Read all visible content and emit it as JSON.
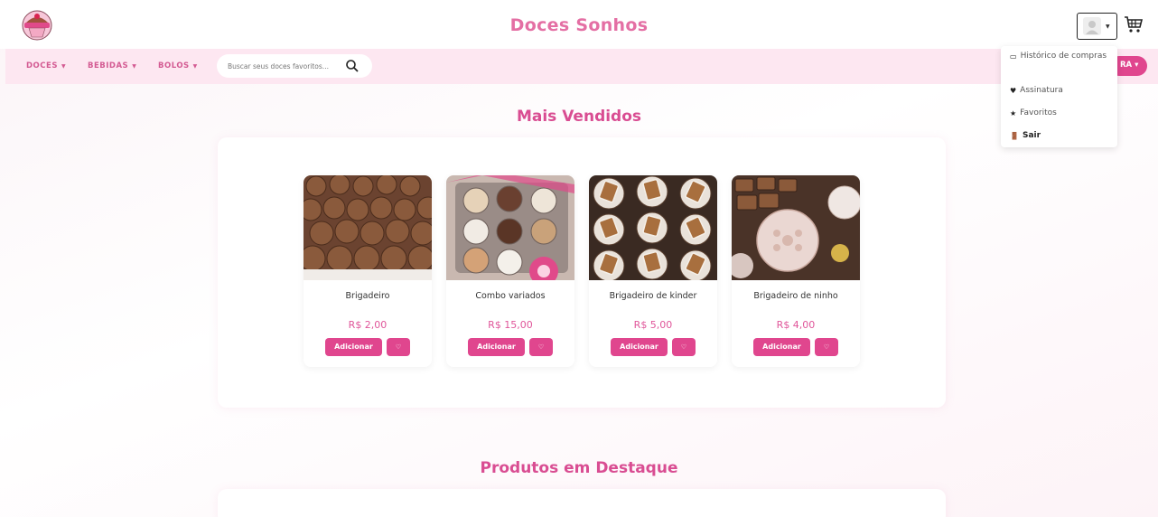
{
  "header": {
    "brand": "Doces Sonhos",
    "logo_icon": "cupcake-logo-icon",
    "user_icon": "user-avatar-icon",
    "cart_icon": "cart-icon"
  },
  "nav": {
    "items": [
      {
        "label": "DOCES"
      },
      {
        "label": "BEBIDAS"
      },
      {
        "label": "BOLOS"
      }
    ],
    "search_placeholder": "Buscar seus doces favoritos...",
    "right_pill": "RA ▾"
  },
  "user_menu": {
    "items": [
      {
        "label": "Histórico de compras",
        "glyph": "▭"
      },
      {
        "label": "Assinatura",
        "glyph": "♥"
      },
      {
        "label": "Favoritos",
        "glyph": "★"
      },
      {
        "label": "Sair",
        "glyph": "🚪"
      }
    ]
  },
  "sections": {
    "best_sellers_title": "Mais Vendidos",
    "featured_title": "Produtos em Destaque"
  },
  "products": [
    {
      "name": "Brigadeiro",
      "price": "R$ 2,00",
      "add_label": "Adicionar",
      "fav_glyph": "♡"
    },
    {
      "name": "Combo variados",
      "price": "R$ 15,00",
      "add_label": "Adicionar",
      "fav_glyph": "♡"
    },
    {
      "name": "Brigadeiro de kinder",
      "price": "R$ 5,00",
      "add_label": "Adicionar",
      "fav_glyph": "♡"
    },
    {
      "name": "Brigadeiro de ninho",
      "price": "R$ 4,00",
      "add_label": "Adicionar",
      "fav_glyph": "♡"
    }
  ],
  "colors": {
    "brand_pink": "#e46fa4",
    "button_pink": "#e0468e",
    "nav_bg": "#fde7f1"
  }
}
